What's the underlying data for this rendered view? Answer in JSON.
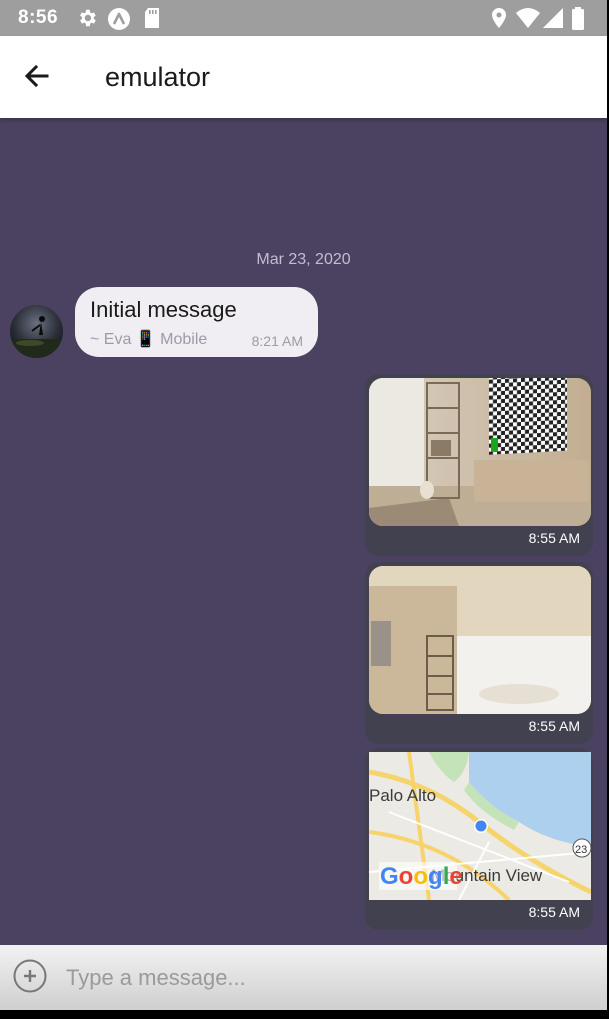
{
  "status_bar": {
    "time": "8:56",
    "icons": [
      "settings-icon",
      "android-icon",
      "sd-card-icon",
      "location-icon",
      "wifi-icon",
      "signal-icon",
      "battery-icon"
    ]
  },
  "app_bar": {
    "title": "emulator",
    "back_icon": "arrow-back-icon"
  },
  "chat": {
    "date_separator": "Mar 23, 2020",
    "incoming_message": {
      "text": "Initial message",
      "meta": "~ Eva 📱 Mobile",
      "time": "8:21 AM"
    },
    "outgoing_messages": [
      {
        "type": "image",
        "content": "living-room-render",
        "time": "8:55 AM"
      },
      {
        "type": "image",
        "content": "room-interior-render",
        "time": "8:55 AM"
      },
      {
        "type": "map",
        "map_labels": [
          "Palo Alto",
          "Mountain View",
          "Google",
          "23"
        ],
        "time": "8:55 AM"
      }
    ]
  },
  "composer": {
    "placeholder": "Type a message...",
    "add_icon": "add-circle-icon"
  },
  "colors": {
    "chat_background": "#4a4260",
    "outgoing_bubble": "#41414f",
    "incoming_bubble": "#f0eef3",
    "status_bar": "#9e9e9e"
  }
}
